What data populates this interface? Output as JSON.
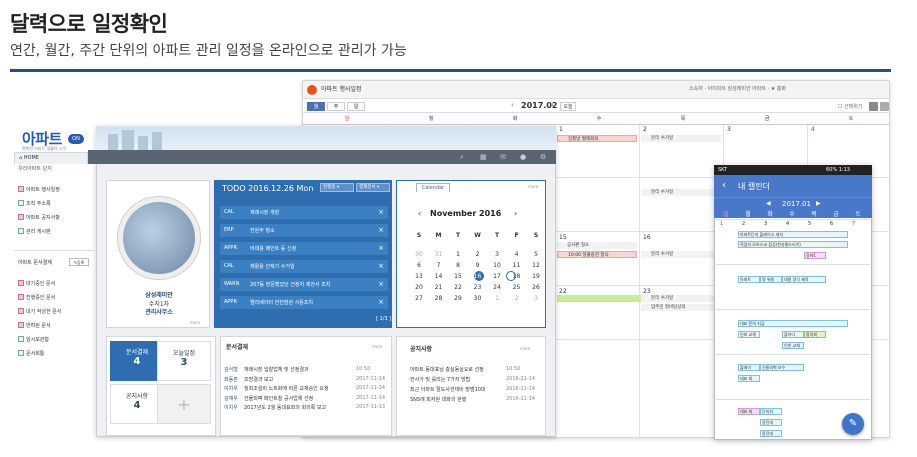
{
  "headline": "달력으로 일정확인",
  "subline": "연간, 월간, 주간 단위의 아파트 관리 일정을 온라인으로 관리가 가능",
  "calendar": {
    "title": "아파트 행사일정",
    "top_right": "소속처 · 아이피트 삼성래미안 아파트 · ★ 홈화",
    "tabs": [
      "월",
      "주",
      "일"
    ],
    "month": "2017.02",
    "today_label": "오늘",
    "checkbox_label": "선택위기",
    "dates_row1": [
      "1",
      "2",
      "3",
      "4"
    ],
    "dates_row3": [
      "15",
      "16"
    ],
    "dates_row4": [
      "22",
      "23"
    ],
    "events": [
      "강풍방 월례회의",
      "분리 수거일",
      "분리 수거일",
      "공사판 청소",
      "10:00 일출승진 정식",
      "분리 수거일",
      "분리 수거일",
      "입주민 정비담상의"
    ]
  },
  "dashboard": {
    "logo": "아파트",
    "logo_badge": "ON",
    "logo_sub": "행복한 아파트 생활의 시작",
    "home_tab": "HOME",
    "home_sub": "우리아파트 단지",
    "menu_items": [
      "아파트 행사일정",
      "조직 주소록",
      "아파트 공지사항",
      "관리 게시판"
    ],
    "doc_header": "아파트 문서결재",
    "doc_btn": "등록",
    "doc_items": [
      "대기중인 문서",
      "진행중인 문서",
      "내가 작성한 문서",
      "반려된 문서",
      "임시보관함",
      "문서회통"
    ],
    "profile_name": "삼성래미안",
    "profile_role": "수지1차",
    "profile_office": "관리사무소",
    "more": "more",
    "todo_title": "TODO 2016.12.26 Mon",
    "todo_sel1": "진행중 ▾",
    "todo_sel2": "결재문서 ▾",
    "todo_pager": "[ 1/3 ]",
    "todo_rows": [
      {
        "k": "CAL",
        "v": "재래시장 개장"
      },
      {
        "k": "ERP",
        "v": "전원주 청소"
      },
      {
        "k": "APPR",
        "v": "비데용 페인트 등 신청"
      },
      {
        "k": "CAL",
        "v": "재활용 선재기 수거일"
      },
      {
        "k": "WARN",
        "v": "207동 방문했었던 건청처 제안서 조치"
      },
      {
        "k": "APPR",
        "v": "엘리베이터 안전점검 사용조치"
      }
    ],
    "cal_tab": "Calendar",
    "cal_month": "November 2016",
    "cal_dow": [
      "S",
      "M",
      "T",
      "W",
      "T",
      "F",
      "S"
    ],
    "cal_days": [
      [
        "30",
        "31",
        "1",
        "2",
        "3",
        "4",
        "5"
      ],
      [
        "6",
        "7",
        "8",
        "9",
        "10",
        "11",
        "12"
      ],
      [
        "13",
        "14",
        "15",
        "16",
        "17",
        "18",
        "19"
      ],
      [
        "20",
        "21",
        "22",
        "23",
        "24",
        "25",
        "26"
      ],
      [
        "27",
        "28",
        "29",
        "30",
        "1",
        "2",
        "3"
      ]
    ],
    "tiles": [
      {
        "label": "문서결재",
        "value": "4"
      },
      {
        "label": "오늘일정",
        "value": "3"
      },
      {
        "label": "공지사항",
        "value": "4"
      },
      {
        "label": "+",
        "value": ""
      }
    ],
    "doc_panel_title": "문서결재",
    "doc_panel_rows": [
      {
        "who": "김식형",
        "t": "재래시장 입찰업체 및 선정결과",
        "d": "10:50"
      },
      {
        "who": "최동훈",
        "t": "조방결과 보고",
        "d": "2017-11-14"
      },
      {
        "who": "이치우",
        "t": "징회조설비 노트화에 따른 교체승인 요청",
        "d": "2017-11-14"
      },
      {
        "who": "김재우",
        "t": "건물외벽 페인트칠 공사업체 선정",
        "d": "2017-11-14"
      },
      {
        "who": "이치우",
        "t": "2017년도 2월 동대표회의 회의록 보고",
        "d": "2017-11-13"
      }
    ],
    "notice_title": "공지사항",
    "notice_rows": [
      {
        "t": "아파트 동대표님 층실동실요로 선정",
        "d": "10:50"
      },
      {
        "t": "한사가 및 를리는 7가지 방법",
        "d": "2016-11-14"
      },
      {
        "t": "최근 아파트 절도사건대비 방범10대",
        "d": "2016-11-14"
      },
      {
        "t": "SNS에 회자된 대화의 관행",
        "d": "2016-11-14"
      }
    ]
  },
  "phone": {
    "carrier": "SKT",
    "status_right": "60% 1:13",
    "title": "내 캘린더",
    "month": "2017.01",
    "dow": [
      "일",
      "월",
      "화",
      "수",
      "목",
      "금",
      "토"
    ],
    "row1": [
      "1",
      "2",
      "3",
      "4",
      "5",
      "6",
      "7"
    ],
    "events": [
      "아파트단지 플레이스 세차",
      "직업자 모하스코 점검(찬성물드리기)",
      "강하1",
      "아파트",
      "정 위원",
      "대원 양식 제작",
      "대표 문의 지급",
      "인비 교체",
      "플러디",
      "합의회",
      "인빈 교체",
      "플레이",
      "건물외벽 보수",
      "대표 회",
      "대표 회",
      "단지지",
      "응진대",
      "응진대"
    ],
    "fab": "✎"
  },
  "colors": {
    "accent": "#2b4a86",
    "todo": "#2e6eb0",
    "phone": "#4a78c9",
    "sunday": "#d23b3b",
    "saturday": "#3b63d2"
  }
}
